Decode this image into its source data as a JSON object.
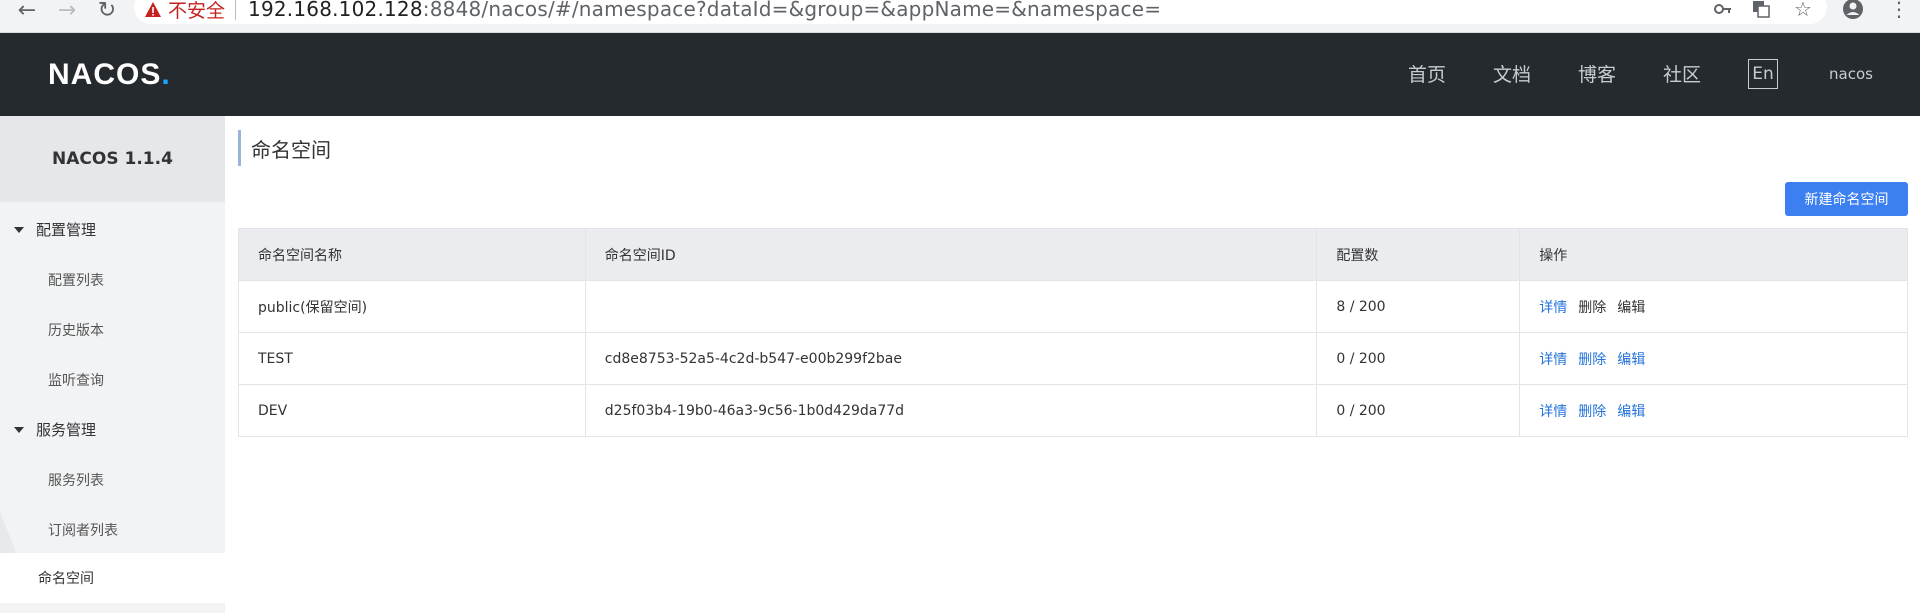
{
  "browser": {
    "insecure_label": "不安全",
    "url_host": "192.168.102.128",
    "url_rest": ":8848/nacos/#/namespace?dataId=&group=&appName=&namespace="
  },
  "header": {
    "logo": "NACOS",
    "logo_dot": ".",
    "nav": [
      "首页",
      "文档",
      "博客",
      "社区"
    ],
    "lang": "En",
    "user": "nacos"
  },
  "sidebar": {
    "title": "NACOS 1.1.4",
    "groups": [
      {
        "label": "配置管理",
        "items": [
          "配置列表",
          "历史版本",
          "监听查询"
        ]
      },
      {
        "label": "服务管理",
        "items": [
          "服务列表",
          "订阅者列表"
        ]
      }
    ],
    "active": "命名空间"
  },
  "main": {
    "title": "命名空间",
    "new_button": "新建命名空间",
    "columns": [
      "命名空间名称",
      "命名空间ID",
      "配置数",
      "操作"
    ],
    "rows": [
      {
        "name": "public(保留空间)",
        "id": "",
        "count": "8 / 200",
        "actions": [
          "详情",
          "删除",
          "编辑"
        ]
      },
      {
        "name": "TEST",
        "id": "cd8e8753-52a5-4c2d-b547-e00b299f2bae",
        "count": "0 / 200",
        "actions": [
          "详情",
          "删除",
          "编辑"
        ]
      },
      {
        "name": "DEV",
        "id": "d25f03b4-19b0-46a3-9c56-1b0d429da77d",
        "count": "0 / 200",
        "actions": [
          "详情",
          "删除",
          "编辑"
        ]
      }
    ]
  },
  "colors": {
    "header_bg": "#252a2f",
    "accent": "#3b7ff0",
    "link": "#2473d9"
  }
}
